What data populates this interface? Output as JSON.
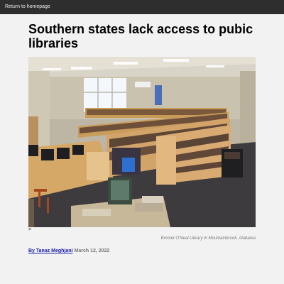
{
  "nav": {
    "home_link": "Return to homepage"
  },
  "article": {
    "headline": "Southern states lack access to pubic libraries",
    "stray_char": ">",
    "photo_caption": "Emmet O'Neal Library in Mountainbrook, Alabama",
    "byline_prefix": "By ",
    "author": "Tanaz Meghjani",
    "date": "March 12, 2022"
  },
  "colors": {
    "topbar": "#2e2e2e",
    "page_bg": "#f2f2f2",
    "author_link": "#1a1aa6"
  }
}
